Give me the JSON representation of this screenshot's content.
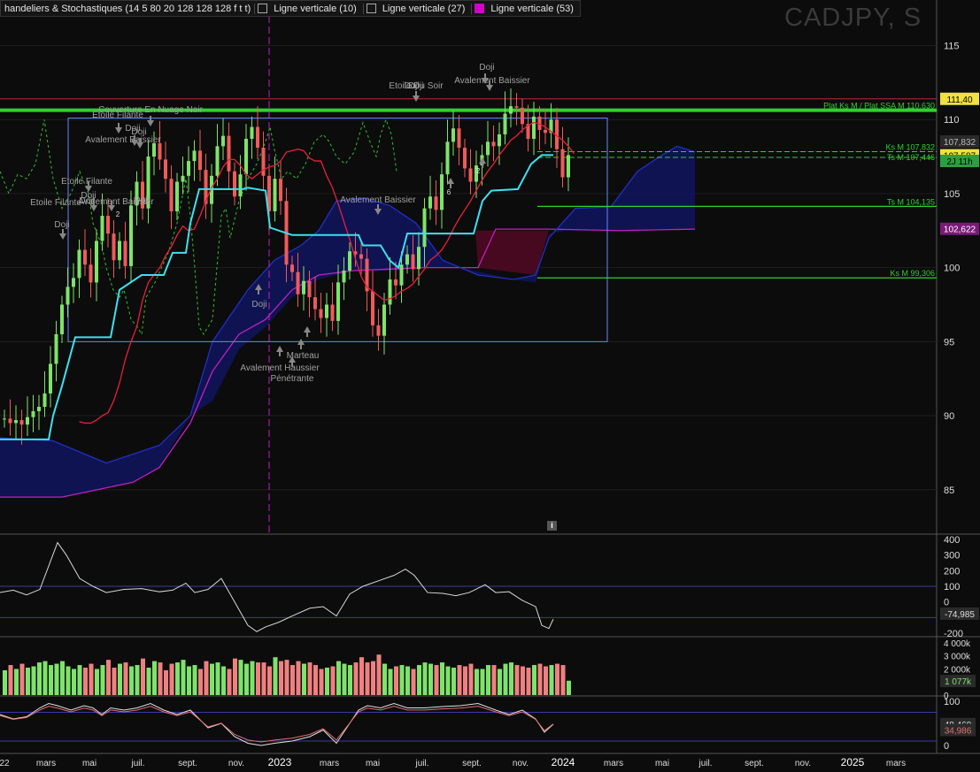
{
  "header": {
    "indicators_label": "handeliers & Stochastiques (14 5 80 20 128 128 128 f t t)",
    "vline1": "Ligne verticale (10)",
    "vline2": "Ligne verticale (27)",
    "vline3": "Ligne verticale (53)",
    "symbol": "CADJPY, S",
    "info_icon": "info-icon"
  },
  "colors": {
    "up": "#7ee36a",
    "down": "#f05a5a",
    "tenkan": "#e8203a",
    "kijun": "#3ee0f0",
    "chikou": "#2fbf2f",
    "ssb": "#c020c0",
    "cloud_bull": "#10145a",
    "cloud_bear": "#4a0a22",
    "hline_green": "#2fd02f",
    "hline_red": "#b23030",
    "box": "#6a86ff",
    "vline_mag": "#c020c0",
    "volume_up": "#7ee36a",
    "volume_down": "#f08080"
  },
  "price_axis": {
    "ticks": [
      "115",
      "110",
      "105",
      "100",
      "95",
      "90",
      "85"
    ],
    "badges": [
      {
        "text": "111,40",
        "bg": "#f0e040",
        "fg": "#000"
      },
      {
        "text": "107,587",
        "bg": "#f0e040",
        "fg": "#000"
      },
      {
        "text": "107,832",
        "bg": "#2a2a2a",
        "fg": "#bbb"
      },
      {
        "text": "2J 11h",
        "bg": "#2aa040",
        "fg": "#000"
      },
      {
        "text": "102,622",
        "bg": "#7a1a7a",
        "fg": "#fff"
      }
    ]
  },
  "hline_labels": [
    "Plat Ks M / Plat SSA M 110,630",
    "Ks M 107,832",
    "Ts M 107,446",
    "Ts M 104,135",
    "Ks M 99,306"
  ],
  "annotations": [
    "Couverture En Nuage Noir",
    "Etoile Filante",
    "Doji",
    "Doji",
    "Avalement Baissier",
    "Etoile Filante",
    "Doji",
    "Doji",
    "Etoile Filante",
    "Avalement Baissier",
    "Doji",
    "Avalement Baissier",
    "Doji",
    "Doji",
    "Marteau",
    "Avalement Haussier",
    "Pénétrante",
    "Etoile Du Soir",
    "Doji",
    "Doji",
    "Avalement Baissier",
    "Doji",
    "2",
    "2",
    "6",
    "2"
  ],
  "osc_axis": {
    "ticks": [
      "400",
      "300",
      "200",
      "100",
      "0",
      "-200"
    ],
    "badge": "-74,985"
  },
  "vol_axis": {
    "ticks": [
      "4 000k",
      "3 000k",
      "2 000k",
      "1 000k",
      "0"
    ],
    "badge": "1 077k"
  },
  "stoch_axis": {
    "ticks": [
      "100",
      "0"
    ],
    "badge1": "48,469",
    "badge2": "34,986"
  },
  "time_axis": {
    "labels": [
      "22",
      "mars",
      "mai",
      "juil.",
      "sept.",
      "nov.",
      "2023",
      "mars",
      "mai",
      "juil.",
      "sept.",
      "nov.",
      "2024",
      "mars",
      "mai",
      "juil.",
      "sept.",
      "nov.",
      "2025",
      "mars"
    ]
  },
  "chart_data": {
    "type": "candlestick",
    "title": "CADJPY, S",
    "timeframe": "weekly",
    "ylim": [
      82,
      117
    ],
    "levels": {
      "plat_ks_ssa": 110.63,
      "resistance": 111.4,
      "ks_m_1": 107.832,
      "ts_m_1": 107.446,
      "ts_m_2": 104.135,
      "ks_m_2": 99.306,
      "last": 107.587,
      "ssb_last": 102.622
    },
    "close": [
      89.8,
      89.5,
      89.7,
      89.4,
      89.9,
      90.3,
      90.6,
      91.5,
      93.5,
      95.5,
      97.5,
      98.7,
      99.3,
      101.2,
      100.2,
      99.0,
      101.8,
      103.5,
      102.3,
      100.5,
      101.8,
      100.1,
      104.2,
      105.8,
      104.0,
      107.5,
      108.4,
      107.3,
      106.0,
      103.8,
      105.8,
      106.2,
      107.2,
      107.9,
      106.6,
      104.3,
      106.2,
      108.2,
      108.9,
      106.5,
      104.8,
      106.3,
      108.7,
      109.5,
      108.1,
      106.2,
      103.8,
      106.0,
      104.5,
      100.2,
      99.7,
      98.2,
      99.1,
      98.0,
      97.2,
      96.6,
      97.5,
      96.4,
      99.0,
      99.8,
      101.1,
      100.9,
      100.6,
      98.4,
      96.1,
      95.4,
      97.5,
      99.2,
      98.8,
      100.2,
      100.9,
      99.9,
      101.4,
      104.0,
      104.8,
      103.9,
      106.3,
      108.5,
      109.4,
      108.1,
      106.7,
      105.8,
      106.9,
      107.6,
      108.5,
      108.2,
      109.0,
      110.4,
      110.9,
      110.8,
      109.7,
      108.7,
      110.2,
      109.3,
      109.1,
      110.0,
      108.0,
      106.1,
      107.6
    ],
    "tenkan": [
      89.6,
      89.5,
      89.5,
      89.7,
      90.0,
      90.2,
      91.0,
      92.2,
      93.8,
      95.0,
      96.0,
      97.8,
      99.0,
      99.5,
      100.0,
      100.8,
      101.4,
      102.2,
      102.8,
      102.5,
      102.6,
      103.5,
      104.5,
      105.4,
      106.0,
      106.8,
      107.3,
      107.3,
      106.9,
      106.3,
      106.0,
      106.3,
      106.6,
      106.8,
      106.9,
      107.2,
      107.8,
      107.9,
      108.0,
      107.9,
      107.4,
      107.2,
      107.2,
      106.2,
      105.4,
      104.3,
      103.1,
      101.9,
      100.6,
      99.4,
      98.7,
      98.4,
      98.1,
      97.8,
      97.9,
      98.1,
      98.4,
      98.6,
      98.9,
      99.4,
      99.9,
      100.5,
      100.8,
      101.2,
      101.8,
      102.6,
      103.3,
      103.9,
      104.5,
      105.2,
      105.9,
      106.5,
      107.0,
      107.6,
      108.1,
      108.6,
      108.9,
      109.3,
      109.6,
      109.8,
      109.7,
      109.5,
      109.2,
      108.9,
      108.6,
      108.2,
      107.7
    ],
    "kijun": [
      89.0,
      89.0,
      89.0,
      89.0,
      89.0,
      89.6,
      90.2,
      91.5,
      93.2,
      95.0,
      96.5,
      97.3,
      98.0,
      99.0,
      100.0,
      100.5,
      101.0,
      101.0,
      101.0,
      101.5,
      102.5,
      104.0,
      105.2,
      105.2,
      105.2,
      105.5,
      105.5,
      105.5,
      104.5,
      103.2,
      102.2,
      102.2,
      102.2,
      102.2,
      102.2,
      102.2,
      102.2,
      102.2,
      102.2,
      102.2,
      102.2,
      102.2,
      102.4,
      102.9,
      102.9,
      102.9,
      102.9,
      101.0,
      100.2,
      100.2,
      100.7,
      101.5,
      102.5,
      103.7,
      104.8,
      105.4,
      106.2,
      107.0,
      107.4,
      107.6,
      107.8
    ],
    "volume": [
      1.9,
      2.3,
      2.0,
      2.4,
      2.1,
      2.2,
      2.5,
      2.6,
      2.3,
      2.4,
      2.6,
      2.2,
      2.0,
      2.3,
      2.1,
      2.4,
      2.0,
      2.3,
      2.7,
      2.1,
      2.4,
      2.5,
      2.2,
      2.3,
      2.8,
      2.1,
      2.6,
      2.5,
      1.9,
      2.4,
      2.5,
      2.7,
      2.2,
      2.3,
      2.0,
      2.6,
      2.4,
      2.5,
      2.2,
      2.0,
      2.8,
      2.7,
      2.4,
      2.6,
      2.5,
      2.5,
      2.2,
      2.9,
      2.6,
      2.7,
      2.3,
      2.6,
      2.4,
      2.5,
      2.3,
      2.0,
      2.1,
      2.2,
      2.6,
      2.4,
      2.3,
      2.5,
      2.9,
      2.5,
      2.6,
      3.1,
      2.4,
      2.0,
      2.2,
      2.3,
      2.2,
      2.0,
      2.3,
      2.5,
      2.4,
      2.3,
      2.5,
      2.2,
      2.1,
      2.3,
      2.2,
      2.4,
      2.0,
      2.0,
      2.3,
      2.3,
      2.0,
      2.4,
      2.5,
      2.3,
      2.2,
      2.1,
      2.3,
      2.4,
      2.2,
      2.3,
      2.4,
      2.3,
      1.1
    ]
  }
}
